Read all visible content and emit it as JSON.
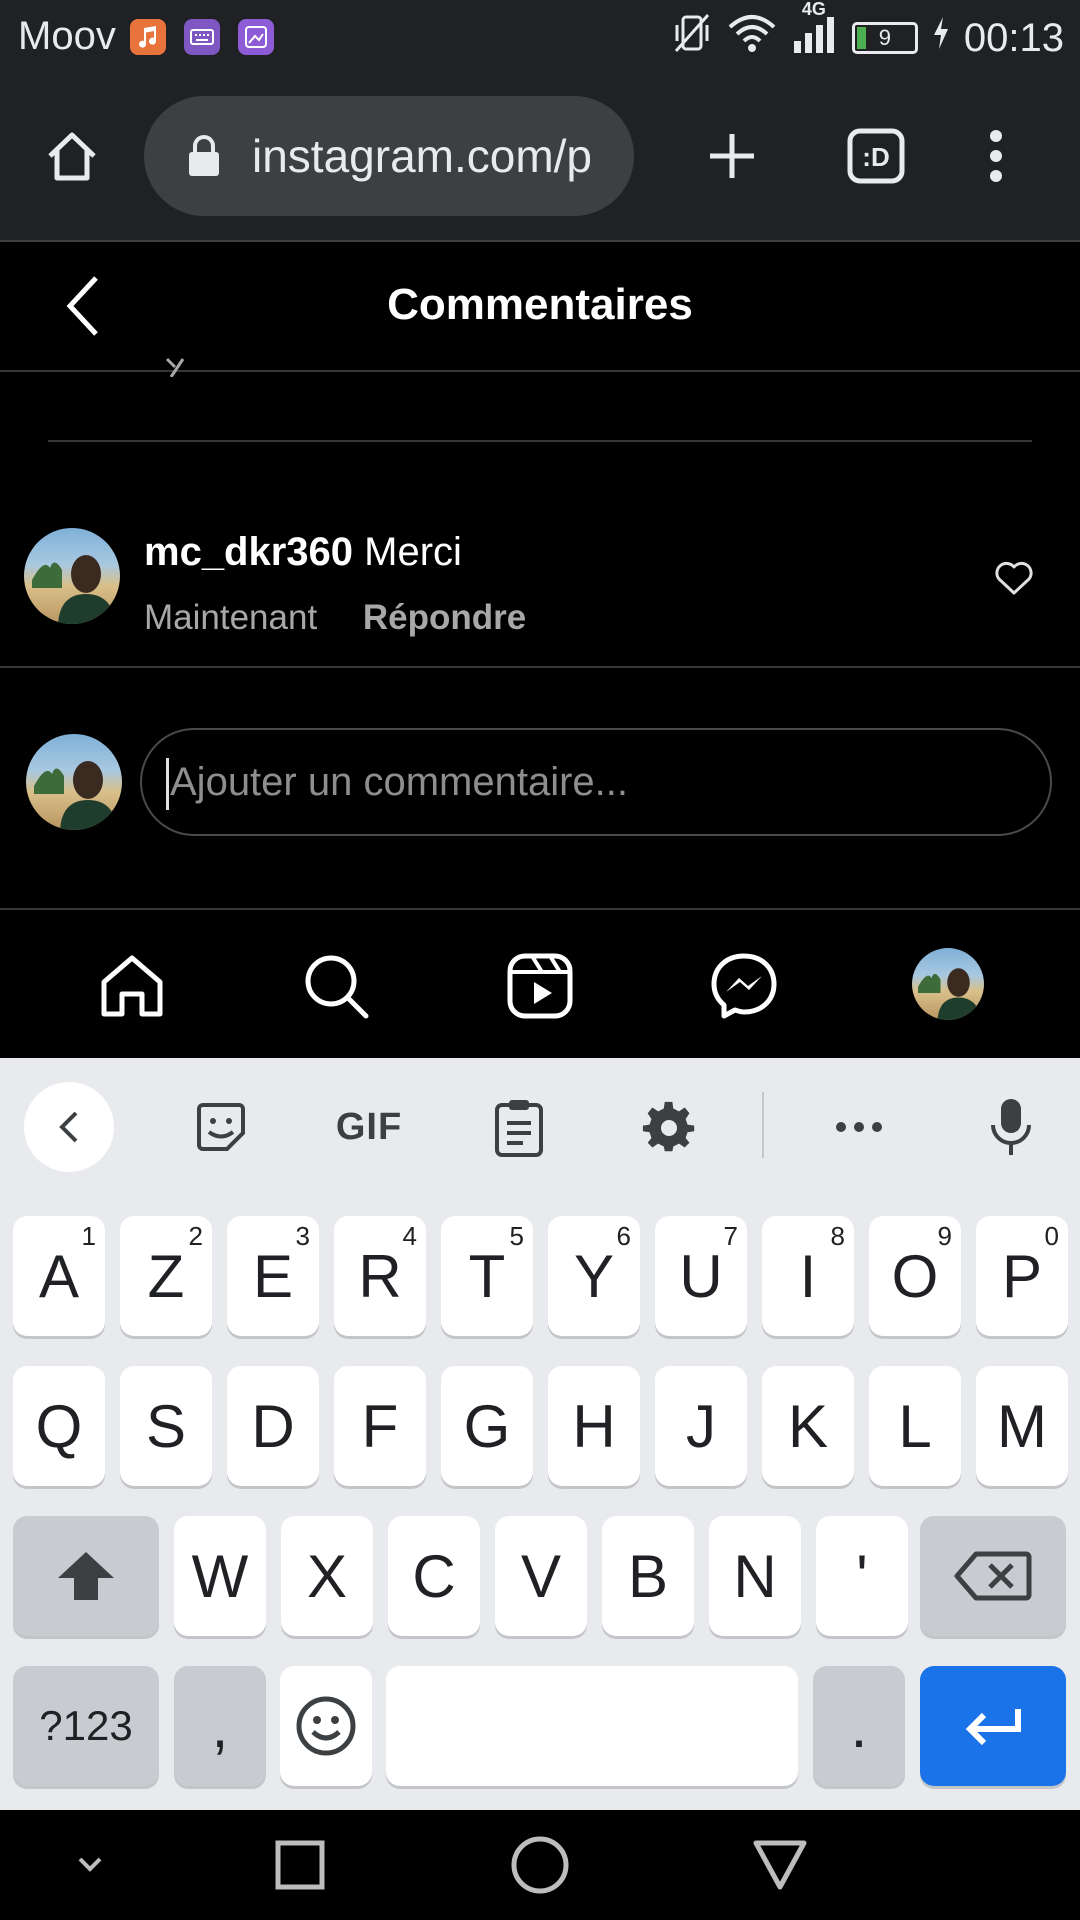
{
  "status_bar": {
    "carrier": "Moov",
    "network": "4G",
    "battery": "9",
    "time": "00:13"
  },
  "browser": {
    "url": "instagram.com/p"
  },
  "header": {
    "title": "Commentaires"
  },
  "comment": {
    "username": "mc_dkr360",
    "text": "Merci",
    "timestamp": "Maintenant",
    "reply_label": "Répondre"
  },
  "composer": {
    "placeholder": "Ajouter un commentaire..."
  },
  "keyboard": {
    "toolbar": {
      "gif_label": "GIF"
    },
    "row1": [
      {
        "label": "A",
        "hint": "1"
      },
      {
        "label": "Z",
        "hint": "2"
      },
      {
        "label": "E",
        "hint": "3"
      },
      {
        "label": "R",
        "hint": "4"
      },
      {
        "label": "T",
        "hint": "5"
      },
      {
        "label": "Y",
        "hint": "6"
      },
      {
        "label": "U",
        "hint": "7"
      },
      {
        "label": "I",
        "hint": "8"
      },
      {
        "label": "O",
        "hint": "9"
      },
      {
        "label": "P",
        "hint": "0"
      }
    ],
    "row2": [
      "Q",
      "S",
      "D",
      "F",
      "G",
      "H",
      "J",
      "K",
      "L",
      "M"
    ],
    "row3": [
      "W",
      "X",
      "C",
      "V",
      "B",
      "N",
      "'"
    ],
    "row4": {
      "symbols": "?123",
      "comma": ",",
      "period": "."
    }
  },
  "colors": {
    "enter_key": "#1a73e8",
    "browser_bg": "#202124",
    "keyboard_bg": "#e8eaed"
  }
}
